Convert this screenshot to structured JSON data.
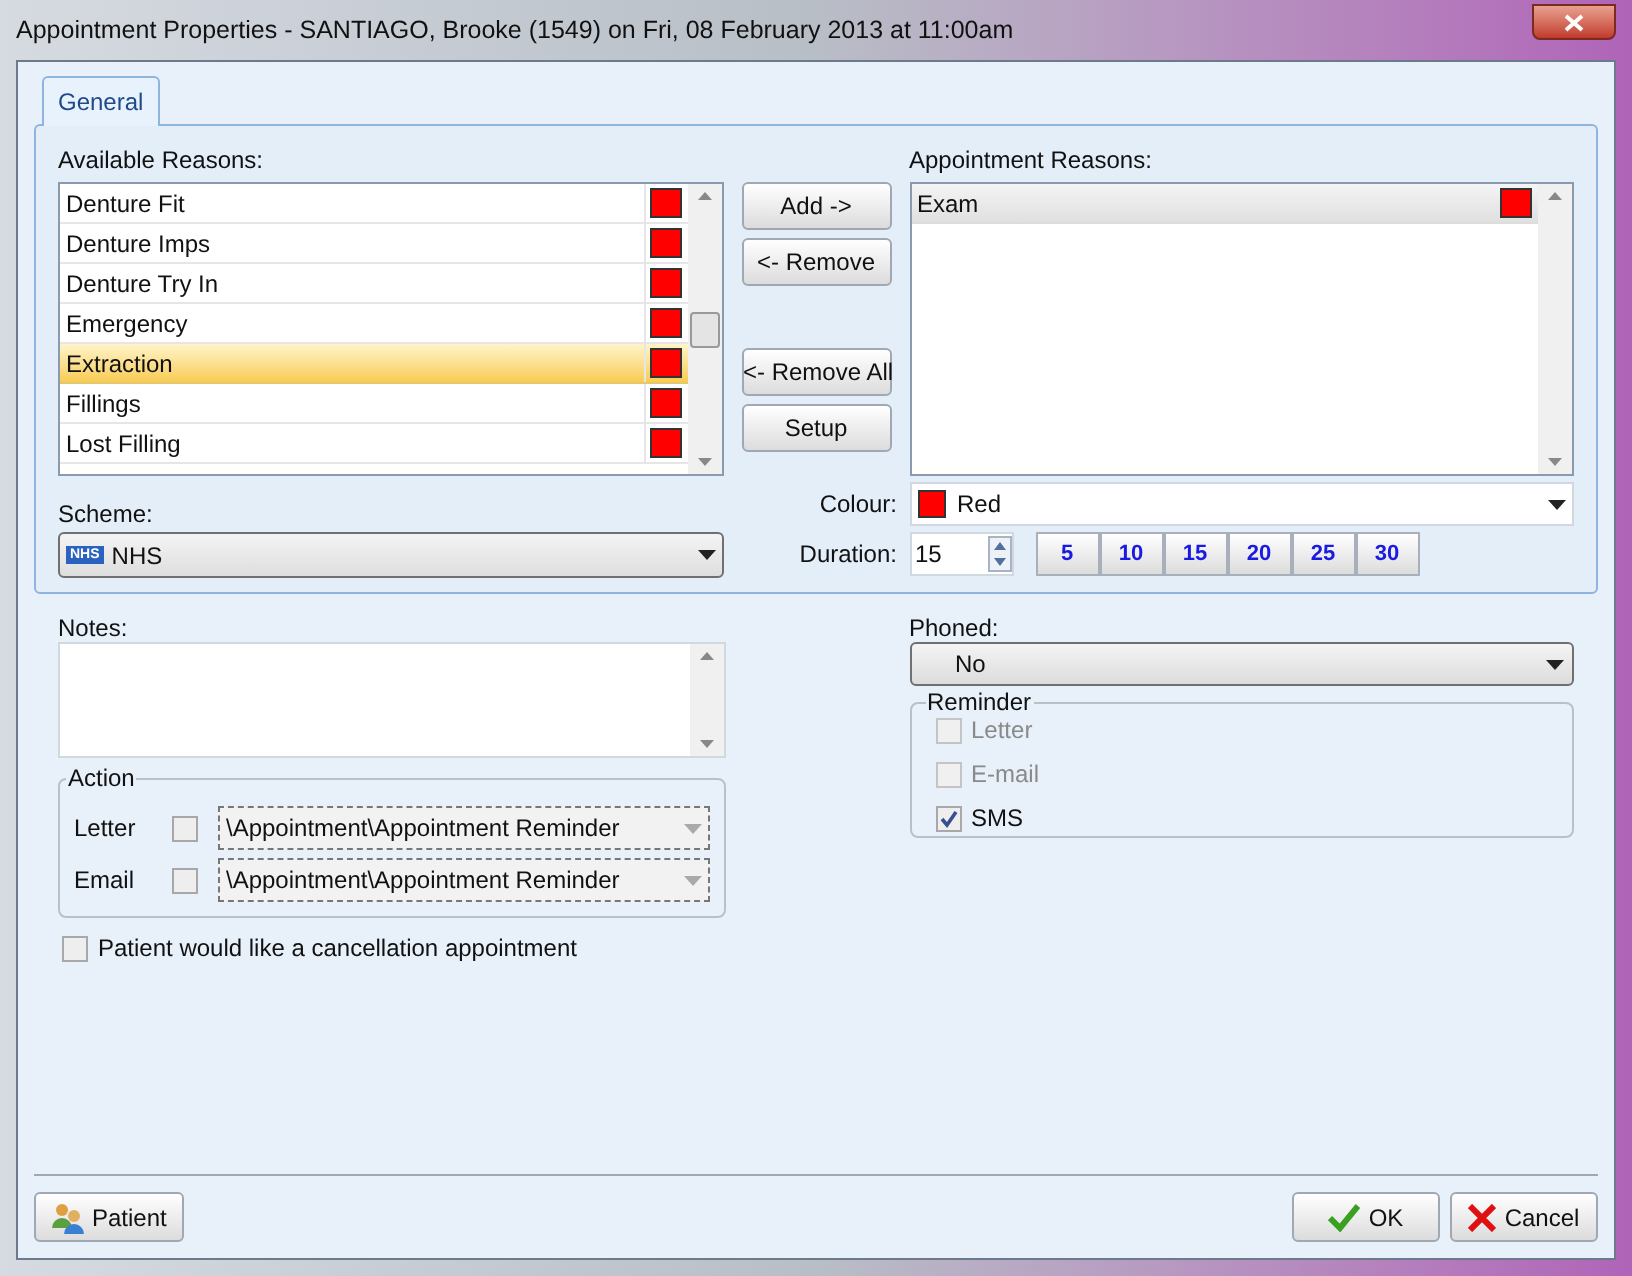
{
  "window": {
    "title": "Appointment Properties - SANTIAGO, Brooke (1549) on Fri, 08 February 2013 at 11:00am"
  },
  "tabs": [
    {
      "label": "General",
      "selected": true
    }
  ],
  "available_reasons": {
    "label": "Available Reasons:",
    "items": [
      {
        "name": "Denture Fit",
        "color": "#ff0000",
        "selected": false
      },
      {
        "name": "Denture Imps",
        "color": "#ff0000",
        "selected": false
      },
      {
        "name": "Denture Try In",
        "color": "#ff0000",
        "selected": false
      },
      {
        "name": "Emergency",
        "color": "#ff0000",
        "selected": false
      },
      {
        "name": "Extraction",
        "color": "#ff0000",
        "selected": true
      },
      {
        "name": "Fillings",
        "color": "#ff0000",
        "selected": false
      },
      {
        "name": "Lost Filling",
        "color": "#ff0000",
        "selected": false
      }
    ]
  },
  "transfer_buttons": [
    "Add ->",
    "<- Remove",
    "<- Remove All",
    "Setup"
  ],
  "appointment_reasons": {
    "label": "Appointment Reasons:",
    "items": [
      {
        "name": "Exam",
        "color": "#ff0000"
      }
    ]
  },
  "scheme": {
    "label": "Scheme:",
    "badge": "NHS",
    "value": "NHS"
  },
  "colour": {
    "label": "Colour:",
    "value": "Red",
    "color": "#ff0000"
  },
  "duration": {
    "label": "Duration:",
    "value": "15",
    "presets": [
      "5",
      "10",
      "15",
      "20",
      "25",
      "30"
    ]
  },
  "notes": {
    "label": "Notes:"
  },
  "action": {
    "title": "Action",
    "rows": [
      {
        "label": "Letter",
        "checked": false,
        "template": "\\Appointment\\Appointment Reminder"
      },
      {
        "label": "Email",
        "checked": false,
        "template": "\\Appointment\\Appointment Reminder"
      }
    ]
  },
  "cancellation": {
    "label": "Patient would like a cancellation appointment",
    "checked": false
  },
  "phoned": {
    "label": "Phoned:",
    "value": "No"
  },
  "reminder": {
    "title": "Reminder",
    "options": [
      {
        "label": "Letter",
        "checked": false,
        "disabled": true
      },
      {
        "label": "E-mail",
        "checked": false,
        "disabled": true
      },
      {
        "label": "SMS",
        "checked": true,
        "disabled": false
      }
    ]
  },
  "buttons": {
    "patient": "Patient",
    "ok": "OK",
    "cancel": "Cancel"
  }
}
